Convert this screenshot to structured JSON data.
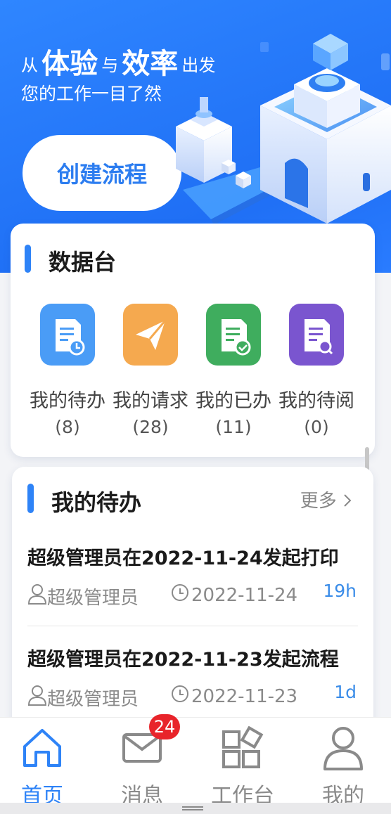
{
  "hero": {
    "title_prefix": "从",
    "title_word1": "体验",
    "title_mid": "与",
    "title_word2": "效率",
    "title_suffix": "出发",
    "subtitle": "您的工作一目了然",
    "create_button": "创建流程"
  },
  "data_panel": {
    "title": "数据台",
    "stats": [
      {
        "label": "我的待办",
        "count": "(8)",
        "icon": "document-clock-icon",
        "color": "#4a9cf6"
      },
      {
        "label": "我的请求",
        "count": "(28)",
        "icon": "paper-plane-icon",
        "color": "#f5a94f"
      },
      {
        "label": "我的已办",
        "count": "(11)",
        "icon": "document-check-icon",
        "color": "#3fad5e"
      },
      {
        "label": "我的待阅",
        "count": "(0)",
        "icon": "document-search-icon",
        "color": "#7a55cf"
      }
    ]
  },
  "todo": {
    "title": "我的待办",
    "more_label": "更多",
    "items": [
      {
        "title": "超级管理员在2022-11-24发起打印",
        "user": "超级管理员",
        "date": "2022-11-24",
        "ago": "19h"
      },
      {
        "title": "超级管理员在2022-11-23发起流程",
        "user": "超级管理员",
        "date": "2022-11-23",
        "ago": "1d"
      }
    ]
  },
  "tabbar": {
    "tabs": [
      {
        "label": "首页",
        "icon": "home-icon",
        "active": true
      },
      {
        "label": "消息",
        "icon": "mail-icon",
        "badge": "24"
      },
      {
        "label": "工作台",
        "icon": "apps-icon"
      },
      {
        "label": "我的",
        "icon": "user-icon"
      }
    ]
  },
  "colors": {
    "primary": "#2e83f7",
    "hero_bg": "#1f6ff5",
    "badge": "#e8242a",
    "inactive_tab": "#8a8a8a"
  }
}
